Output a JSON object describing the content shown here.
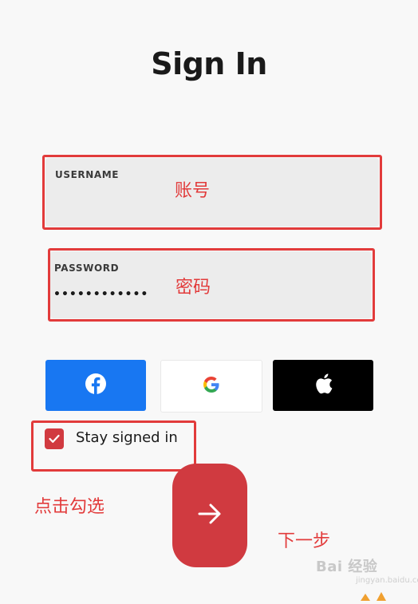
{
  "title": "Sign In",
  "username": {
    "label": "USERNAME",
    "value": ""
  },
  "password": {
    "label": "PASSWORD",
    "value": "••••••••••••"
  },
  "social": [
    {
      "name": "facebook",
      "icon": "facebook-icon",
      "color": "#1877f2"
    },
    {
      "name": "google",
      "icon": "google-icon",
      "color": "#ffffff"
    },
    {
      "name": "apple",
      "icon": "apple-icon",
      "color": "#000000"
    }
  ],
  "stay_signed_in": {
    "label": "Stay signed in",
    "checked": true
  },
  "annotations": {
    "username": "账号",
    "password": "密码",
    "checkbox": "点击勾选",
    "next": "下一步"
  },
  "colors": {
    "accent": "#d03a40",
    "annotation": "#e23b3b"
  },
  "watermark": {
    "text": "Bai 经验",
    "sub": "jingyan.baidu.com"
  }
}
